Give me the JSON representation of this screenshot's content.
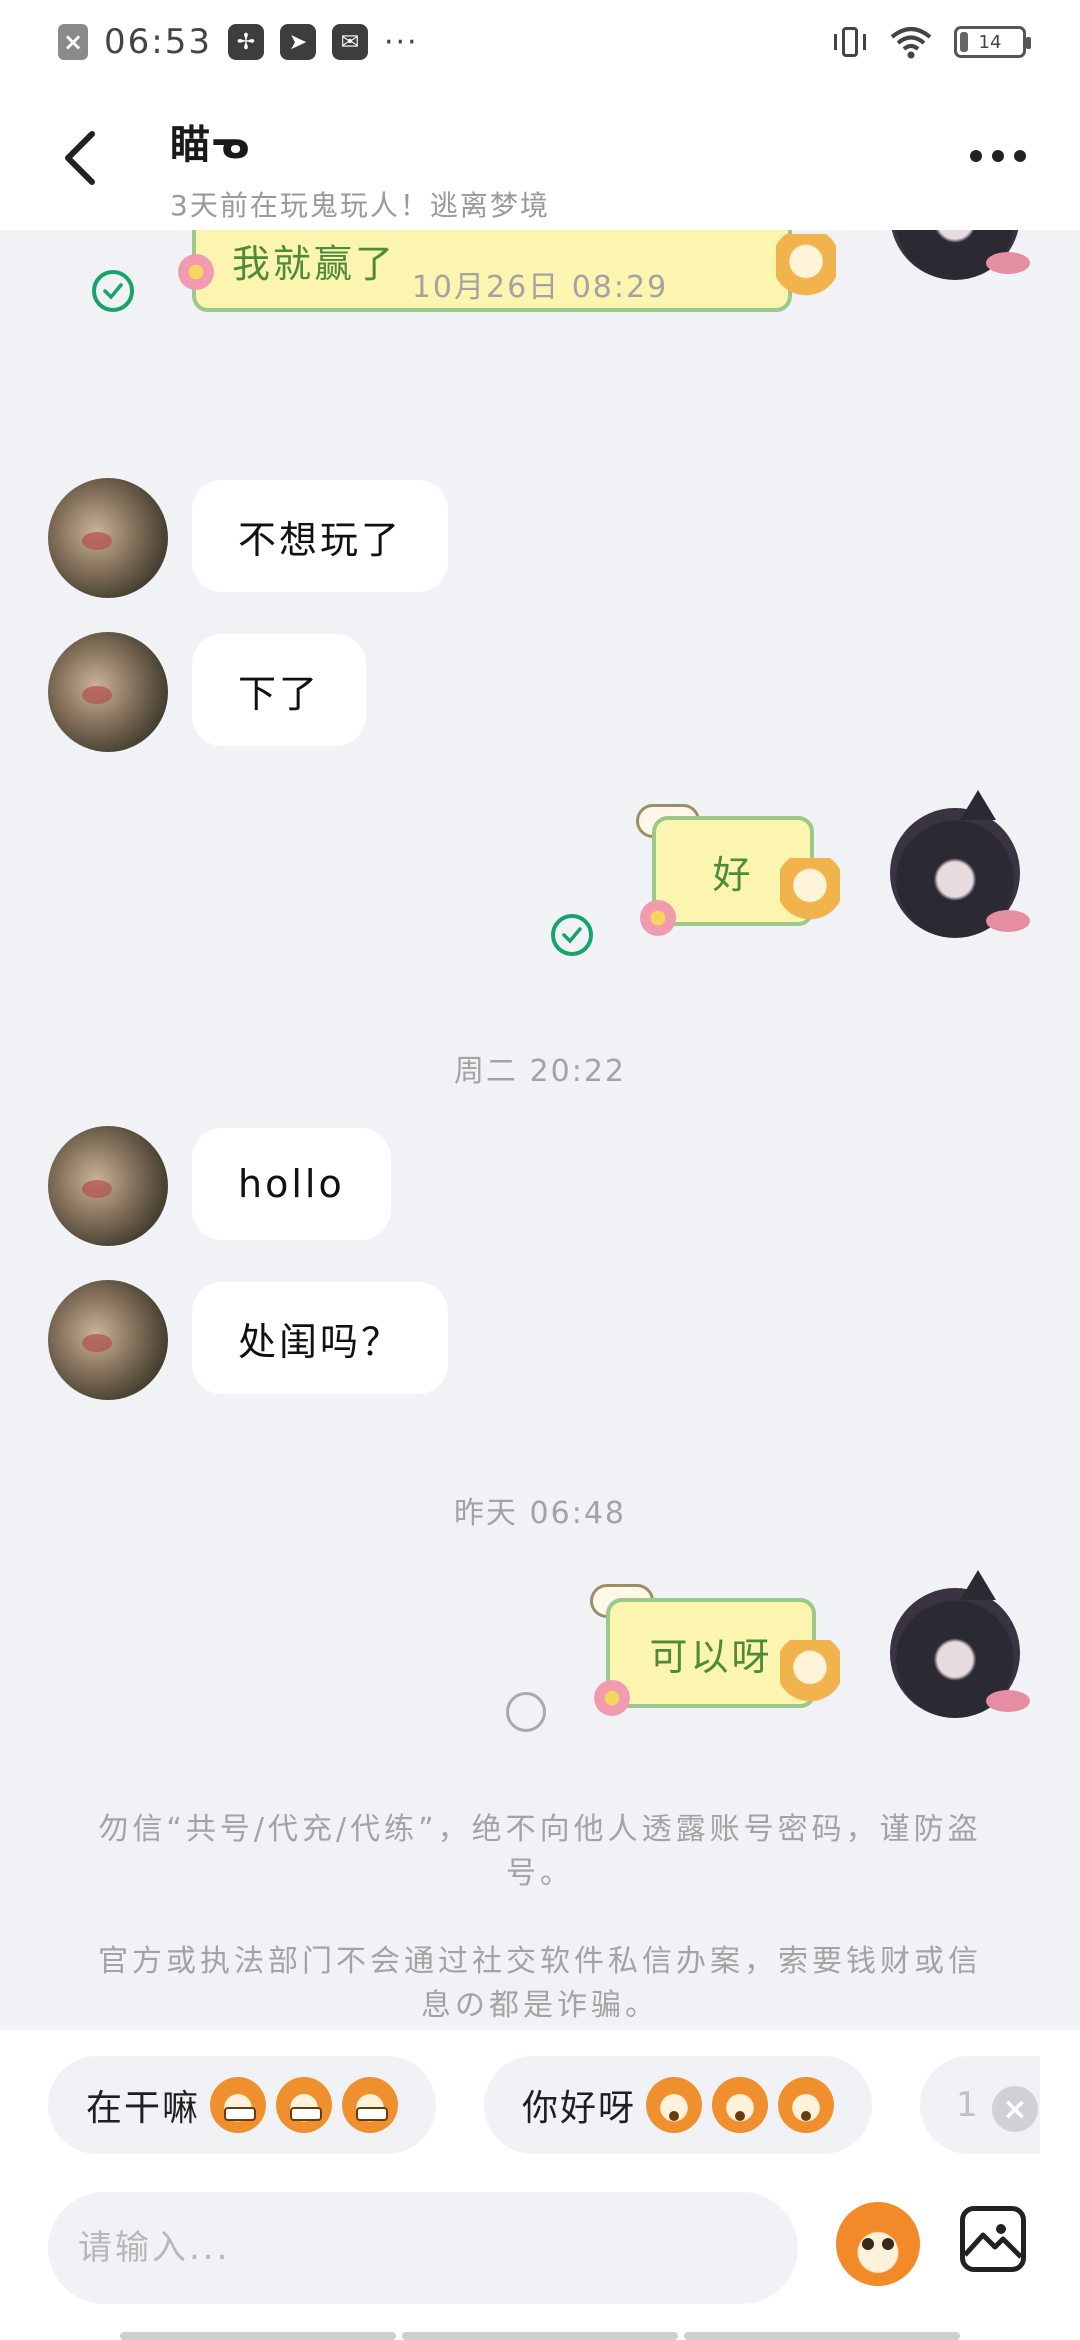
{
  "status_bar": {
    "time": "06:53",
    "more": "···",
    "battery": "14"
  },
  "header": {
    "back_icon": "chevron-left-icon",
    "contact_name": "瞄ᓀ",
    "contact_status": "3天前在玩鬼玩人！逃离梦境",
    "more_icon": "more-horizontal-icon"
  },
  "chat": {
    "top_partial_text": "我就赢了",
    "timestamps": [
      "10月26日 08:29",
      "周二 20:22",
      "昨天 06:48"
    ],
    "messages_1": [
      "不想玩了",
      "下了"
    ],
    "reply_1": "好",
    "messages_2": [
      "hollo",
      "处闺吗？"
    ],
    "reply_2": "可以呀",
    "notice_1": "勿信“共号/代充/代练”，绝不向他人透露账号密码，谨防盗号。",
    "notice_2": "官方或执法部门不会通过社交软件私信办案，索要钱财或信息の都是诈骗。"
  },
  "quick_replies": {
    "chip_1": "在干嘛",
    "chip_2": "你好呀",
    "chip_partial": "1",
    "close": "×"
  },
  "input": {
    "placeholder": "请输入..."
  },
  "colors": {
    "check": "#17a36b",
    "bubble_right_bg": "#fbf5b0",
    "bubble_right_border": "#9cc98a",
    "bubble_right_text": "#4f8a3b"
  }
}
